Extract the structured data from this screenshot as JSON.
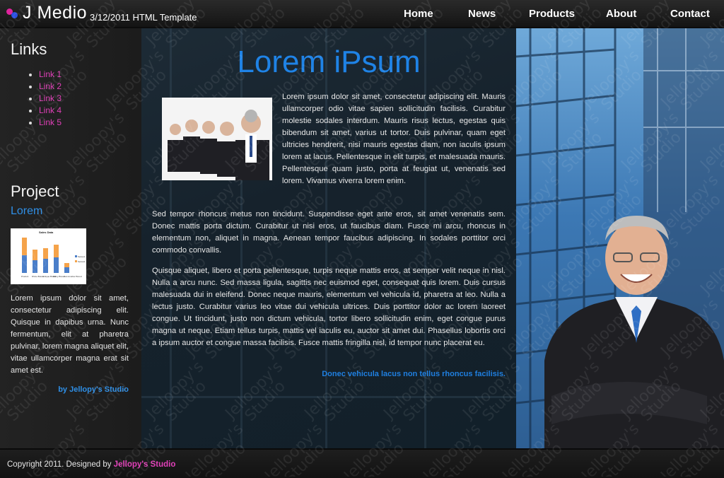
{
  "header": {
    "title": "J Medio",
    "tagline": "3/12/2011 HTML Template",
    "accent_pink": "#e0249e",
    "accent_blue": "#2a4fe0"
  },
  "nav": {
    "items": [
      {
        "label": "Home"
      },
      {
        "label": "News"
      },
      {
        "label": "Products"
      },
      {
        "label": "About"
      },
      {
        "label": "Contact"
      }
    ]
  },
  "sidebar": {
    "links_heading": "Links",
    "links": [
      {
        "label": "Link 1"
      },
      {
        "label": "Link 2"
      },
      {
        "label": "Link 3"
      },
      {
        "label": "Link 4"
      },
      {
        "label": "Link 5"
      }
    ],
    "project_heading": "Project",
    "project_subheading": "Lorem",
    "project_text": "Lorem ipsum dolor sit amet, consectetur adipiscing elit. Quisque in dapibus urna. Nunc fermentum, elit at pharetra pulvinar, lorem magna aliquet elit, vitae ullamcorper magna erat sit amet est.",
    "project_credit": "by Jellopy's Studio",
    "thumbnail_chart": {
      "title": "Sales Data",
      "categories": [
        "Product",
        "Rhine Brand",
        "Antique Brand",
        "Shiny Brand",
        "Just Another Brand"
      ],
      "series": [
        {
          "name": "Series1",
          "color": "#4a7ec9",
          "values": [
            25,
            18,
            20,
            22,
            8
          ]
        },
        {
          "name": "Series2",
          "color": "#f5a34a",
          "values": [
            25,
            15,
            15,
            18,
            6
          ]
        }
      ]
    }
  },
  "main": {
    "title": "Lorem iPsum",
    "para1": "Lorem ipsum dolor sit amet, consectetur adipiscing elit. Mauris ullamcorper odio vitae sapien sollicitudin facilisis. Curabitur molestie sodales interdum. Mauris risus lectus, egestas quis bibendum sit amet, varius ut tortor. Duis pulvinar, quam eget ultricies hendrerit, nisi mauris egestas diam, non iaculis ipsum lorem at lacus. Pellentesque in elit turpis, et malesuada mauris. Pellentesque quam justo, porta at feugiat ut, venenatis sed lorem. Vivamus viverra lorem enim.",
    "para2": "Sed tempor rhoncus metus non tincidunt. Suspendisse eget ante eros, sit amet venenatis sem. Donec mattis porta dictum. Curabitur ut nisi eros, ut faucibus diam. Fusce mi arcu, rhoncus in elementum non, aliquet in magna. Aenean tempor faucibus adipiscing. In sodales porttitor orci commodo convallis.",
    "para3": "Quisque aliquet, libero et porta pellentesque, turpis neque mattis eros, at semper velit neque in nisl. Nulla a arcu nunc. Sed massa ligula, sagittis nec euismod eget, consequat quis lorem. Duis cursus malesuada dui in eleifend. Donec neque mauris, elementum vel vehicula id, pharetra at leo. Nulla a lectus justo. Curabitur varius leo vitae dui vehicula ultrices. Duis porttitor dolor ac lorem laoreet congue. Ut tincidunt, justo non dictum vehicula, tortor libero sollicitudin enim, eget congue purus magna ut neque. Etiam tellus turpis, mattis vel iaculis eu, auctor sit amet dui. Phasellus lobortis orci a ipsum auctor et congue massa facilisis. Fusce mattis fringilla nisl, id tempor nunc placerat eu.",
    "credit": "Donec vehicula lacus non tellus rhoncus facilisis."
  },
  "footer": {
    "text": "Copyright 2011. Designed by",
    "link": "Jellopy's Studio"
  },
  "watermark": "Jelloopy's\nStudio"
}
